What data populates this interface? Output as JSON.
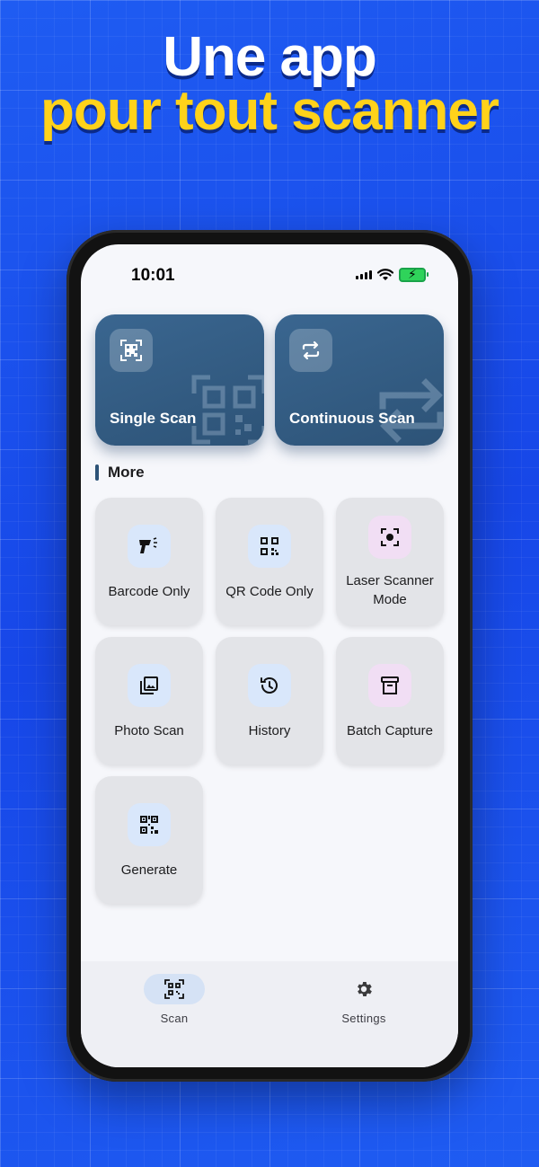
{
  "headline": {
    "line1": "Une app",
    "line2": "pour tout scanner"
  },
  "status_bar": {
    "time": "10:01",
    "icons": [
      "signal-icon",
      "wifi-icon",
      "battery-charging-icon"
    ]
  },
  "primary_actions": [
    {
      "label": "Single Scan",
      "icon": "qr-frame-icon"
    },
    {
      "label": "Continuous Scan",
      "icon": "repeat-icon"
    }
  ],
  "more_section": {
    "title": "More",
    "items": [
      {
        "label": "Barcode Only",
        "icon": "barcode-scanner-icon"
      },
      {
        "label": "QR Code Only",
        "icon": "qr-code-icon"
      },
      {
        "label": "Laser Scanner Mode",
        "icon": "focus-target-icon"
      },
      {
        "label": "Photo Scan",
        "icon": "photo-library-icon"
      },
      {
        "label": "History",
        "icon": "history-icon"
      },
      {
        "label": "Batch Capture",
        "icon": "archive-box-icon"
      },
      {
        "label": "Generate",
        "icon": "qr-generate-icon"
      }
    ]
  },
  "bottom_nav": {
    "items": [
      {
        "label": "Scan",
        "icon": "qr-scan-icon",
        "active": true
      },
      {
        "label": "Settings",
        "icon": "gear-icon",
        "active": false
      }
    ]
  },
  "colors": {
    "background": "#1f5cf2",
    "headline_accent": "#ffd21a",
    "card": "#2d5377",
    "tile": "#e3e4e8"
  }
}
